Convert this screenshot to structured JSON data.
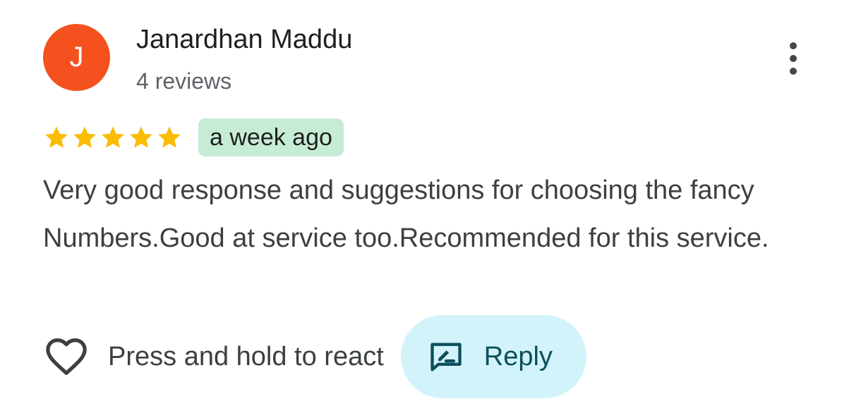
{
  "review": {
    "author": {
      "initial": "J",
      "name": "Janardhan Maddu",
      "meta": "4 reviews",
      "avatar_color": "#f4511e"
    },
    "rating": 5,
    "rating_max": 5,
    "date": "a week ago",
    "text": "Very good response and suggestions for choosing the fancy Numbers.Good at service too.Recommended for this service."
  },
  "actions": {
    "react_label": "Press and hold to react",
    "reply_label": "Reply"
  },
  "icons": {
    "more": "more-vert-icon",
    "star": "star-icon",
    "heart": "heart-outline-icon",
    "reply": "rate-review-icon"
  },
  "colors": {
    "star": "#fbbc04",
    "date_badge_bg": "#c7ecd5",
    "reply_bg": "#d3f3fb",
    "reply_text": "#0b4f5c"
  }
}
